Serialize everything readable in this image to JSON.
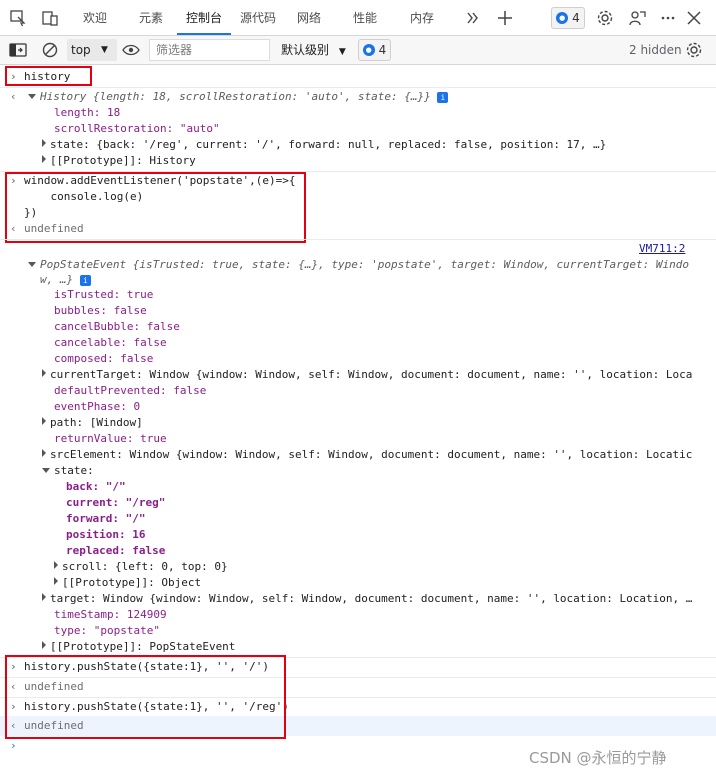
{
  "tabs": [
    {
      "label": "欢迎"
    },
    {
      "label": "元素"
    },
    {
      "label": "控制台",
      "active": true
    },
    {
      "label": "源代码"
    },
    {
      "label": "网络"
    },
    {
      "label": "性能"
    },
    {
      "label": "内存"
    }
  ],
  "toolbar": {
    "issues_count": "4",
    "context": "top",
    "filter_placeholder": "筛选器",
    "levels_label": "默认级别",
    "levels_issues": "4",
    "hidden_label": "2 hidden"
  },
  "console": {
    "cmd1": "history",
    "out1_title": "History {length: 18, scrollRestoration: 'auto', state: {…}}",
    "out1_length": "length: 18",
    "out1_scroll": "scrollRestoration: \"auto\"",
    "out1_state": "state: {back: '/reg', current: '/', forward: null, replaced: false, position: 17, …}",
    "out1_proto": "[[Prototype]]: History",
    "cmd2_line1": "window.addEventListener('popstate',(e)=>{",
    "cmd2_line2": "    console.log(e)",
    "cmd2_line3": "})",
    "undefined": "undefined",
    "source_link": "VM711:2",
    "ev_title": "PopStateEvent {isTrusted: true, state: {…}, type: 'popstate', target: Window, currentTarget: Windo",
    "ev_title2": "w, …}",
    "ev_props": [
      "isTrusted: true",
      "bubbles: false",
      "cancelBubble: false",
      "cancelable: false",
      "composed: false",
      "currentTarget: Window {window: Window, self: Window, document: document, name: '', location: Loca",
      "defaultPrevented: false",
      "eventPhase: 0",
      "path: [Window]",
      "returnValue: true",
      "srcElement: Window {window: Window, self: Window, document: document, name: '', location: Locatic",
      "state:",
      "back: \"/\"",
      "current: \"/reg\"",
      "forward: \"/\"",
      "position: 16",
      "replaced: false",
      "scroll: {left: 0, top: 0}",
      "[[Prototype]]: Object",
      "target: Window {window: Window, self: Window, document: document, name: '', location: Location, …",
      "timeStamp: 124909",
      "type: \"popstate\"",
      "[[Prototype]]: PopStateEvent"
    ],
    "cmd3": "history.pushState({state:1}, '', '/')",
    "cmd4": "history.pushState({state:1}, '', '/reg')"
  },
  "watermark": "CSDN @永恒的宁静"
}
